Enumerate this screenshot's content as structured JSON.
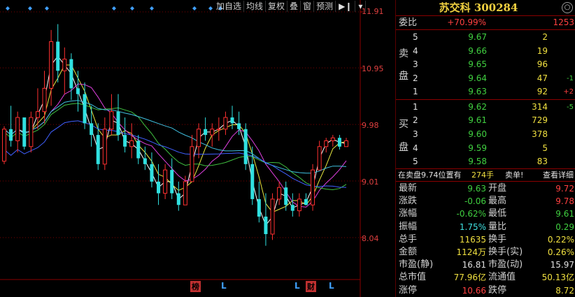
{
  "toolbar": {
    "buttons": [
      "加自选",
      "均线",
      "复权",
      "叠",
      "窗",
      "预测"
    ],
    "icon_pin": "pin-icon",
    "icon_dropdown": "dropdown-arrow-icon"
  },
  "chart": {
    "price_labels": [
      "11.91",
      "10.95",
      "9.98",
      "9.01",
      "8.04"
    ],
    "markers": [
      "榜",
      "L",
      "L",
      "财",
      "L"
    ]
  },
  "chart_data": {
    "type": "candlestick",
    "ylim": [
      8.04,
      11.91
    ],
    "yticks": [
      11.91,
      10.95,
      9.98,
      9.01,
      8.04
    ],
    "candles": [
      [
        9.35,
        9.95,
        9.3,
        9.9
      ],
      [
        9.9,
        10.3,
        9.6,
        9.7
      ],
      [
        9.7,
        10.2,
        9.5,
        10.1
      ],
      [
        10.1,
        10.0,
        9.55,
        9.6
      ],
      [
        9.6,
        10.2,
        9.5,
        10.1
      ],
      [
        10.1,
        10.6,
        9.9,
        10.2
      ],
      [
        10.2,
        10.9,
        10.0,
        10.6
      ],
      [
        10.6,
        11.6,
        10.3,
        11.4
      ],
      [
        11.4,
        11.7,
        10.7,
        10.9
      ],
      [
        10.9,
        11.3,
        10.5,
        11.1
      ],
      [
        11.1,
        11.2,
        10.4,
        10.6
      ],
      [
        10.6,
        10.9,
        10.2,
        10.5
      ],
      [
        10.5,
        10.7,
        9.9,
        10.0
      ],
      [
        10.0,
        10.3,
        9.6,
        9.8
      ],
      [
        9.8,
        10.0,
        9.2,
        9.3
      ],
      [
        9.3,
        10.1,
        9.2,
        9.9
      ],
      [
        9.9,
        10.5,
        9.8,
        10.2
      ],
      [
        10.2,
        10.5,
        9.7,
        9.8
      ],
      [
        9.8,
        10.1,
        9.5,
        9.6
      ],
      [
        9.6,
        10.0,
        9.4,
        9.7
      ],
      [
        9.7,
        9.8,
        9.3,
        9.4
      ],
      [
        9.4,
        9.6,
        9.2,
        9.3
      ],
      [
        9.3,
        9.5,
        8.9,
        9.0
      ],
      [
        9.0,
        9.3,
        8.6,
        8.8
      ],
      [
        8.8,
        9.3,
        8.7,
        9.2
      ],
      [
        9.2,
        9.4,
        8.7,
        8.8
      ],
      [
        8.8,
        9.0,
        8.5,
        8.6
      ],
      [
        8.6,
        9.1,
        8.6,
        9.0
      ],
      [
        9.0,
        9.8,
        9.0,
        9.6
      ],
      [
        9.6,
        10.0,
        9.4,
        9.9
      ],
      [
        9.9,
        10.1,
        9.7,
        9.8
      ],
      [
        9.8,
        10.0,
        9.6,
        9.9
      ],
      [
        9.9,
        10.1,
        9.7,
        9.9
      ],
      [
        9.9,
        10.2,
        9.8,
        10.1
      ],
      [
        10.1,
        10.3,
        9.9,
        10.0
      ],
      [
        10.0,
        10.2,
        9.8,
        9.9
      ],
      [
        9.9,
        10.0,
        9.2,
        9.3
      ],
      [
        9.3,
        9.6,
        8.6,
        8.7
      ],
      [
        8.7,
        9.0,
        8.3,
        8.4
      ],
      [
        8.4,
        8.8,
        7.9,
        8.1
      ],
      [
        8.1,
        8.8,
        8.0,
        8.7
      ],
      [
        8.7,
        9.0,
        8.6,
        8.9
      ],
      [
        8.9,
        9.0,
        8.5,
        8.6
      ],
      [
        8.6,
        8.8,
        8.4,
        8.5
      ],
      [
        8.5,
        8.8,
        8.4,
        8.7
      ],
      [
        8.7,
        8.8,
        8.6,
        8.6
      ],
      [
        8.6,
        9.3,
        8.5,
        9.2
      ],
      [
        9.2,
        9.7,
        9.2,
        9.6
      ],
      [
        9.6,
        9.75,
        9.5,
        9.7
      ],
      [
        9.7,
        9.8,
        9.6,
        9.75
      ],
      [
        9.75,
        9.8,
        9.55,
        9.6
      ],
      [
        9.6,
        9.75,
        9.6,
        9.7
      ]
    ],
    "series": [
      {
        "color": "#ffffff"
      },
      {
        "color": "#e8e840"
      },
      {
        "color": "#e040e0"
      },
      {
        "color": "#40c040"
      },
      {
        "color": "#40c0e0"
      },
      {
        "color": "#4060ff"
      }
    ]
  },
  "panel": {
    "stock_name": "苏交科",
    "stock_code": "300284",
    "close_icon": "settings-circle-icon",
    "weibi_label": "委比",
    "weibi_pct": "+70.99%",
    "weibi_diff": "1253",
    "sell_label_top": "卖",
    "sell_label_bottom": "盘",
    "buy_label_top": "买",
    "buy_label_bottom": "盘",
    "sell": [
      {
        "level": "5",
        "price": "9.67",
        "vol": "2",
        "chg": ""
      },
      {
        "level": "4",
        "price": "9.66",
        "vol": "19",
        "chg": ""
      },
      {
        "level": "3",
        "price": "9.65",
        "vol": "96",
        "chg": ""
      },
      {
        "level": "2",
        "price": "9.64",
        "vol": "47",
        "chg": "-1"
      },
      {
        "level": "1",
        "price": "9.63",
        "vol": "92",
        "chg": "+2"
      }
    ],
    "buy": [
      {
        "level": "1",
        "price": "9.62",
        "vol": "314",
        "chg": "-5"
      },
      {
        "level": "2",
        "price": "9.61",
        "vol": "729",
        "chg": ""
      },
      {
        "level": "3",
        "price": "9.60",
        "vol": "378",
        "chg": ""
      },
      {
        "level": "4",
        "price": "9.59",
        "vol": "5",
        "chg": ""
      },
      {
        "level": "5",
        "price": "9.58",
        "vol": "83",
        "chg": ""
      }
    ],
    "footer": {
      "text": "在卖盘9.74位置有",
      "vol": "274手",
      "tag": "卖单!",
      "link": "查看详细"
    },
    "info": [
      {
        "l1": "最新",
        "v1": "9.63",
        "l2": "开盘",
        "v2": "9.72"
      },
      {
        "l1": "涨跌",
        "v1": "-0.06",
        "l2": "最高",
        "v2": "9.78"
      },
      {
        "l1": "涨幅",
        "v1": "-0.62%",
        "l2": "最低",
        "v2": "9.61"
      },
      {
        "l1": "振幅",
        "v1": "1.75%",
        "l2": "量比",
        "v2": "0.29"
      },
      {
        "l1": "总手",
        "v1": "11635",
        "l2": "换手",
        "v2": "0.22%"
      },
      {
        "l1": "金额",
        "v1": "1124万",
        "l2": "换手(实)",
        "v2": "0.26%"
      },
      {
        "l1": "市盈(静)",
        "v1": "16.81",
        "l2": "市盈(动)",
        "v2": "15.97"
      },
      {
        "l1": "总市值",
        "v1": "77.96亿",
        "l2": "流通值",
        "v2": "50.13亿"
      },
      {
        "l1": "涨停",
        "v1": "10.66",
        "l2": "跌停",
        "v2": "8.72"
      }
    ]
  }
}
